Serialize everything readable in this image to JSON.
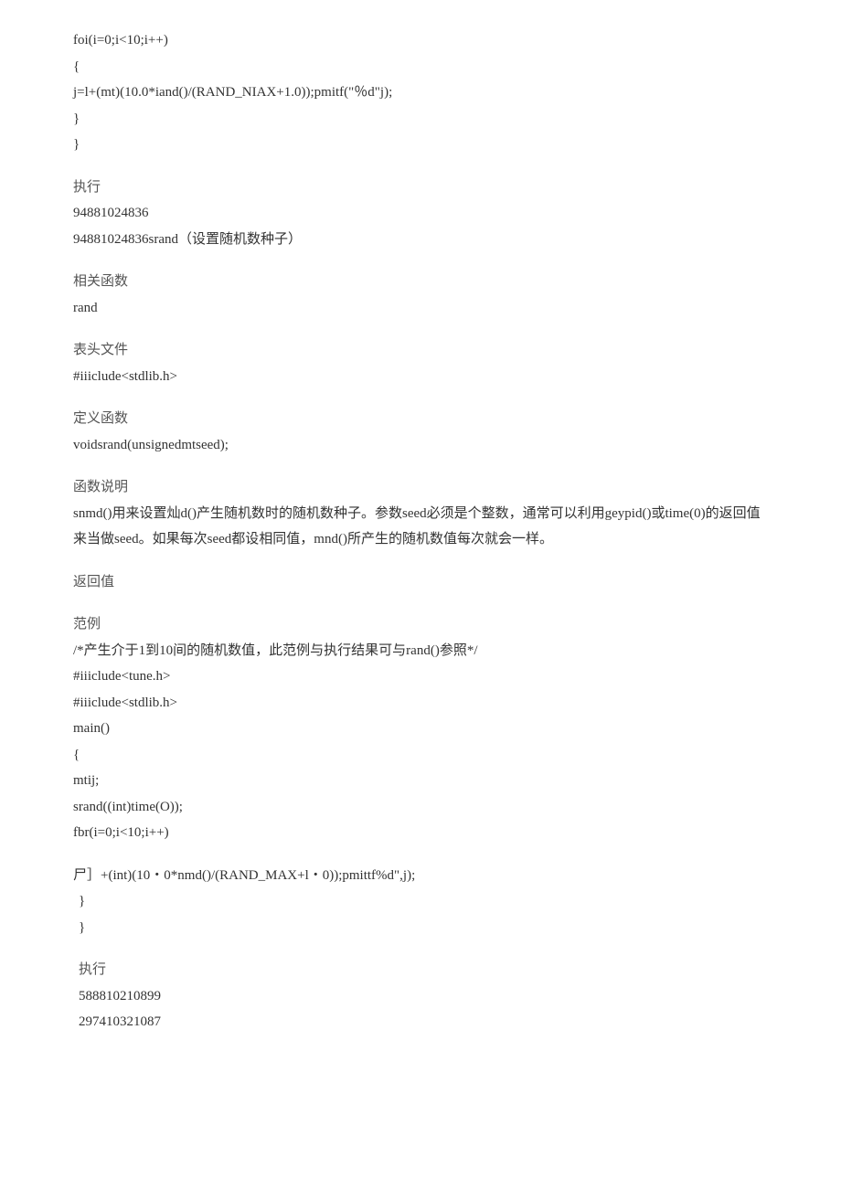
{
  "block1": {
    "l1": "foi(i=0;i<10;i++)",
    "l2": "{",
    "l3": "j=l+(mt)(10.0*iand()/(RAND_NIAX+1.0));pmitf(\"％d\"j);",
    "l4": "}",
    "l5": "}"
  },
  "block2": {
    "header": "执行",
    "l1": "94881024836",
    "l2": "94881024836srand（设置随机数种子）"
  },
  "block3": {
    "header": "相关函数",
    "l1": "rand"
  },
  "block4": {
    "header": "表头文件",
    "l1": "#iiiclude<stdlib.h>"
  },
  "block5": {
    "header": "定义函数",
    "l1": "voidsrand(unsignedmtseed);"
  },
  "block6": {
    "header": "函数说明",
    "l1": "snmd()用来设置灿d()产生随机数时的随机数种子。参数seed必须是个整数，通常可以利用geypid()或time(0)的返回值来当做seed。如果每次seed都设相同值，mnd()所产生的随机数值每次就会一样。"
  },
  "block7": {
    "header": "返回值"
  },
  "block8": {
    "header": "范例",
    "l1": "/*产生介于1到10间的随机数值，此范例与执行结果可与rand()参照*/",
    "l2": "#iiiclude<tune.h>",
    "l3": "#iiiclude<stdlib.h>",
    "l4": "main()",
    "l5": "{",
    "l6": "mtij;",
    "l7": "srand((int)time(O));",
    "l8": "fbr(i=0;i<10;i++)"
  },
  "block9": {
    "l1": "尸］+(int)(10・0*nmd()/(RAND_MAX+l・0));pmittf%d\",j);",
    "l2": "}",
    "l3": "}"
  },
  "block10": {
    "header": "执行",
    "l1": "588810210899",
    "l2": "297410321087"
  }
}
